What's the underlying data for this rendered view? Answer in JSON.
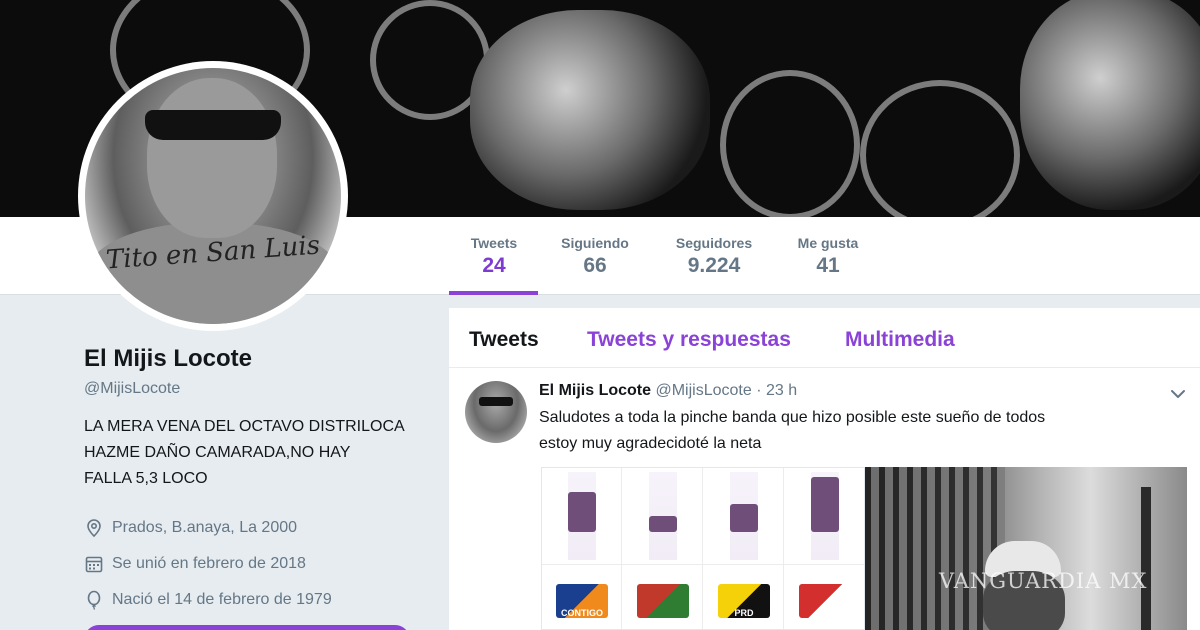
{
  "stats": [
    {
      "label": "Tweets",
      "value": "24"
    },
    {
      "label": "Siguiendo",
      "value": "66"
    },
    {
      "label": "Seguidores",
      "value": "9.224"
    },
    {
      "label": "Me gusta",
      "value": "41"
    }
  ],
  "profile": {
    "avatar_tattoo_text": "Tito en San Luis",
    "name": "El Mijis Locote",
    "handle": "@MijisLocote",
    "bio_lines": [
      "LA MERA VENA DEL OCTAVO DISTRILOCA",
      "HAZME DAÑO CAMARADA,NO HAY",
      "FALLA 5,3 LOCO"
    ],
    "location": "Prados, B.anaya, La 2000",
    "joined": "Se unió en febrero de 2018",
    "birthday": "Nació el 14 de febrero de 1979"
  },
  "tabs": [
    {
      "label": "Tweets",
      "active": true
    },
    {
      "label": "Tweets y respuestas",
      "active": false
    },
    {
      "label": "Multimedia",
      "active": false
    }
  ],
  "tweet": {
    "name": "El Mijis Locote",
    "handle": "@MijisLocote",
    "separator": "·",
    "time": "23 h",
    "text_lines": [
      "Saludotes a toda la pinche banda que hizo posible este sueño de todos",
      "estoy muy agradecidoté la neta"
    ]
  },
  "media": {
    "chart_bar_levels": [
      0.45,
      0.18,
      0.32,
      0.62
    ],
    "logos": [
      {
        "text": "CONTIGO",
        "colors": [
          "#1a3f8f",
          "#f08a1c"
        ]
      },
      {
        "text": "",
        "colors": [
          "#c0392b",
          "#2e7d32"
        ]
      },
      {
        "text": "PRD",
        "colors": [
          "#f5d10a",
          "#111111"
        ]
      },
      {
        "text": "",
        "colors": [
          "#d32f2f",
          "#ffffff"
        ]
      }
    ],
    "watermark": "VANGUARDIA MX"
  },
  "colors": {
    "accent": "#8a43d6",
    "text_secondary": "#657786",
    "background": "#e6ecf0"
  },
  "icons": {
    "location": "location-pin-icon",
    "joined": "calendar-icon",
    "birthday": "balloon-icon",
    "caret": "chevron-down-icon"
  }
}
